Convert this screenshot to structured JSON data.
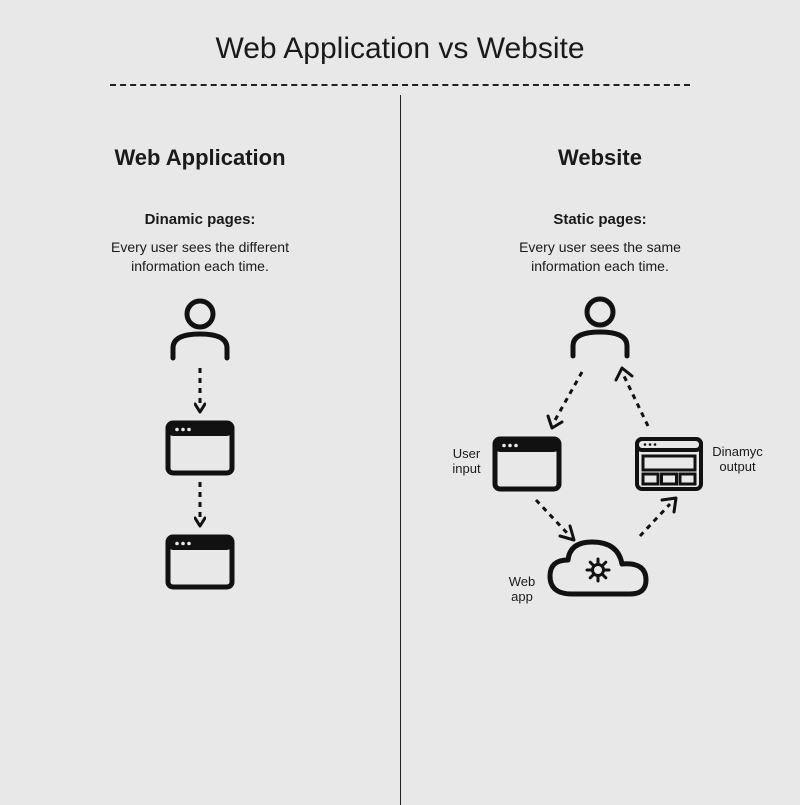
{
  "title": "Web Application vs Website",
  "left": {
    "heading": "Web Application",
    "subheading": "Dinamic pages:",
    "description": "Every user sees the different information each time."
  },
  "right": {
    "heading": "Website",
    "subheading": "Static pages:",
    "description": "Every user sees the same information each time.",
    "labels": {
      "user_input": "User input",
      "dynamic_output": "Dinamyc output",
      "web_app": "Web app"
    }
  }
}
